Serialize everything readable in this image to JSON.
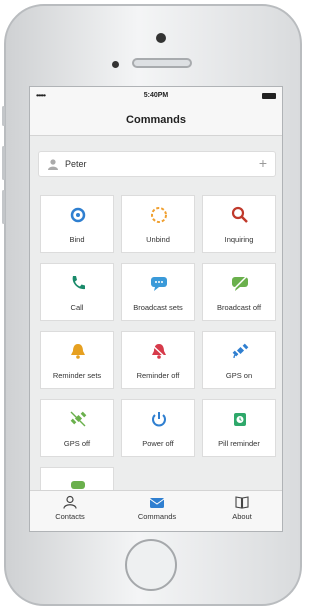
{
  "status": {
    "signal": "•••••",
    "time": "5:40PM"
  },
  "nav": {
    "title": "Commands"
  },
  "user": {
    "name": "Peter",
    "add": "+"
  },
  "commands": [
    {
      "label": "Bind",
      "icon": "bind-icon",
      "color": "#2f7fd0"
    },
    {
      "label": "Unbind",
      "icon": "unbind-icon",
      "color": "#f0a030"
    },
    {
      "label": "Inquiring",
      "icon": "search-icon",
      "color": "#c0392b"
    },
    {
      "label": "Call",
      "icon": "phone-icon",
      "color": "#1a8a6a"
    },
    {
      "label": "Broadcast sets",
      "icon": "broadcast-icon",
      "color": "#3a9ad9"
    },
    {
      "label": "Broadcast off",
      "icon": "broadcast-off-icon",
      "color": "#6ab04c"
    },
    {
      "label": "Reminder sets",
      "icon": "bell-icon",
      "color": "#e6a020"
    },
    {
      "label": "Reminder off",
      "icon": "bell-off-icon",
      "color": "#d63a4a"
    },
    {
      "label": "GPS on",
      "icon": "satellite-icon",
      "color": "#2f7fd0"
    },
    {
      "label": "GPS off",
      "icon": "satellite-off-icon",
      "color": "#6ab04c"
    },
    {
      "label": "Power off",
      "icon": "power-icon",
      "color": "#2f7fd0"
    },
    {
      "label": "Pill reminder",
      "icon": "alarm-clock-icon",
      "color": "#2ea86a"
    },
    {
      "label": "",
      "icon": "more-icon",
      "color": "#6ab04c"
    }
  ],
  "tabs": [
    {
      "label": "Contacts",
      "icon": "contacts-icon"
    },
    {
      "label": "Commands",
      "icon": "commands-icon",
      "color": "#2f7fd0"
    },
    {
      "label": "About",
      "icon": "book-icon"
    }
  ]
}
